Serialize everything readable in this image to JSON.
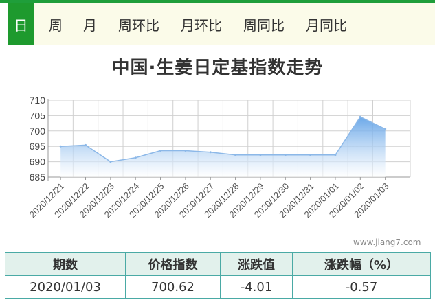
{
  "tabs": [
    {
      "label": "日",
      "active": true
    },
    {
      "label": "周",
      "active": false
    },
    {
      "label": "月",
      "active": false
    },
    {
      "label": "周环比",
      "active": false
    },
    {
      "label": "月环比",
      "active": false
    },
    {
      "label": "周同比",
      "active": false
    },
    {
      "label": "月同比",
      "active": false
    }
  ],
  "title": "中国·生姜日定基指数走势",
  "watermark": "www.jiang7.com",
  "chart_data": {
    "type": "area",
    "title": "中国·生姜日定基指数走势",
    "x": [
      "2020/12/21",
      "2020/12/22",
      "2020/12/23",
      "2020/12/24",
      "2020/12/25",
      "2020/12/26",
      "2020/12/27",
      "2020/12/28",
      "2020/12/29",
      "2020/12/30",
      "2020/12/31",
      "2020/01/01",
      "2020/01/02",
      "2020/01/03"
    ],
    "y_ticks": [
      685,
      690,
      695,
      700,
      705,
      710
    ],
    "ylim": [
      685,
      710
    ],
    "grid": true,
    "series": [
      {
        "values": [
          695.0,
          695.4,
          690.0,
          691.3,
          693.6,
          693.6,
          693.1,
          692.2,
          692.2,
          692.2,
          692.2,
          692.2,
          704.6,
          700.62
        ]
      }
    ],
    "colors": {
      "line": "#8cb8e8",
      "fill_top": "#5a9ee6",
      "fill_bottom": "#ffffff",
      "grid": "#d0d0d0"
    }
  },
  "table": {
    "headers": [
      "期数",
      "价格指数",
      "涨跌值",
      "涨跌幅（%）"
    ],
    "row": [
      "2020/01/03",
      "700.62",
      "-4.01",
      "-0.57"
    ]
  }
}
